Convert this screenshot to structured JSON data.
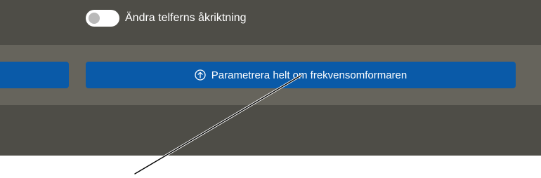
{
  "settings": {
    "toggle_label": "Ändra telferns åkriktning",
    "toggle_state": "off"
  },
  "actions": {
    "left_button_label": "",
    "main_button_label": "Parametrera helt om frekvensomformaren",
    "main_button_icon": "arrow-up-circle-icon"
  },
  "colors": {
    "panel_background": "#4e4d47",
    "band_background": "#66645c",
    "button_background": "#0a5aa8",
    "text": "#ffffff"
  }
}
